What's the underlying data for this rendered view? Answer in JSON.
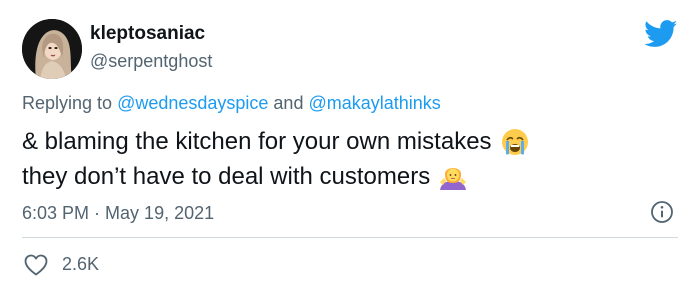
{
  "user": {
    "display_name": "kleptosaniac",
    "handle": "@serpentghost"
  },
  "reply": {
    "prefix": "Replying to ",
    "mention_1": "@wednesdayspice",
    "conjunction": " and ",
    "mention_2": "@makaylathinks"
  },
  "tweet": {
    "line_1": "& blaming the kitchen for your own mistakes",
    "line_1_emoji": "loudly-crying-face-emoji",
    "line_2": " they don’t have to deal with customers",
    "line_2_emoji": "person-shrugging-emoji"
  },
  "meta": {
    "time": "6:03 PM",
    "separator": " · ",
    "date": "May 19, 2021"
  },
  "engagement": {
    "likes": "2.6K"
  },
  "colors": {
    "brand": "#1d9bf0",
    "text": "#0f1419",
    "secondary": "#536471",
    "divider": "#cfd9de"
  },
  "icons": {
    "logo": "twitter-bird-icon",
    "info": "info-icon",
    "like": "heart-icon"
  }
}
